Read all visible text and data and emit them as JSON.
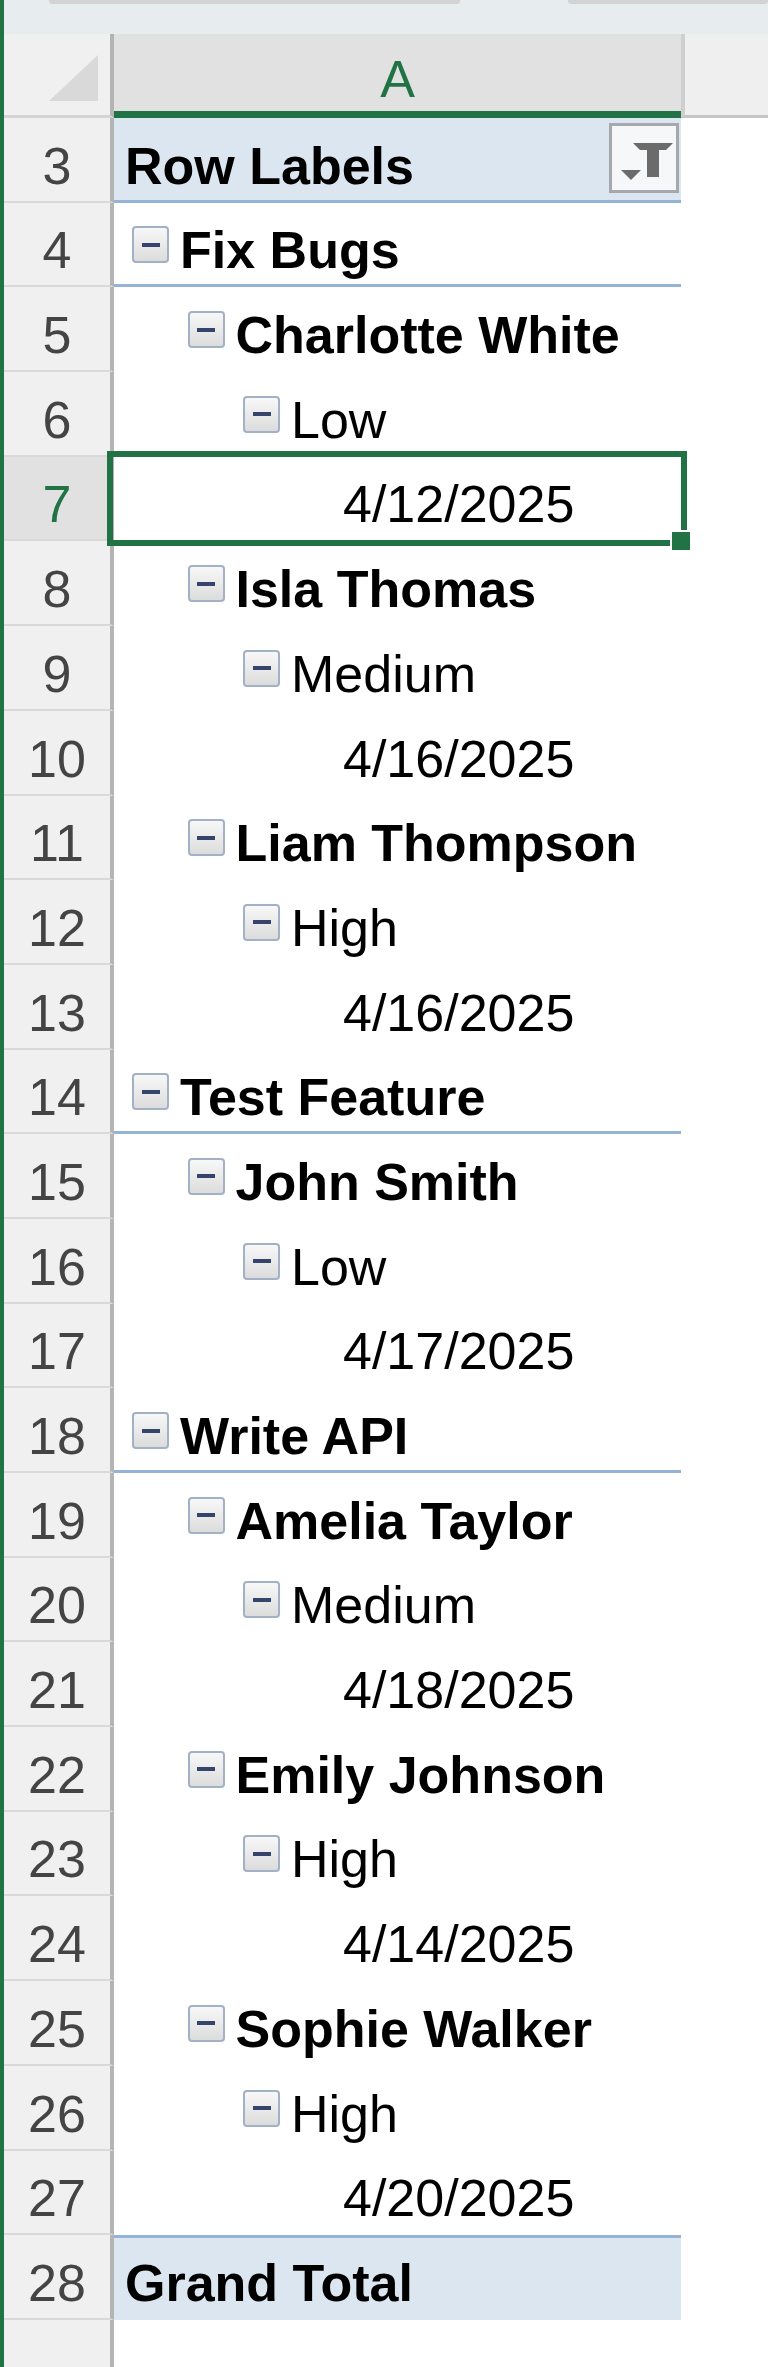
{
  "column_header": {
    "label": "A",
    "selected": true
  },
  "pivot": {
    "header": {
      "row": "3",
      "label": "Row Labels",
      "filtered": true
    },
    "items": [
      {
        "row": "4",
        "label": "Fix Bugs",
        "expanded": true,
        "selected": false,
        "children": [
          {
            "row": "5",
            "label": "Charlotte White",
            "expanded": true,
            "selected": false,
            "children": [
              {
                "row": "6",
                "label": "Low",
                "expanded": true,
                "selected": false,
                "children": [
                  {
                    "row": "7",
                    "label": "4/12/2025",
                    "selected": true
                  }
                ]
              }
            ]
          },
          {
            "row": "8",
            "label": "Isla Thomas",
            "expanded": true,
            "selected": false,
            "children": [
              {
                "row": "9",
                "label": "Medium",
                "expanded": true,
                "selected": false,
                "children": [
                  {
                    "row": "10",
                    "label": "4/16/2025",
                    "selected": false
                  }
                ]
              }
            ]
          },
          {
            "row": "11",
            "label": "Liam Thompson",
            "expanded": true,
            "selected": false,
            "children": [
              {
                "row": "12",
                "label": "High",
                "expanded": true,
                "selected": false,
                "children": [
                  {
                    "row": "13",
                    "label": "4/16/2025",
                    "selected": false
                  }
                ]
              }
            ]
          }
        ]
      },
      {
        "row": "14",
        "label": "Test Feature",
        "expanded": true,
        "selected": false,
        "children": [
          {
            "row": "15",
            "label": "John Smith",
            "expanded": true,
            "selected": false,
            "children": [
              {
                "row": "16",
                "label": "Low",
                "expanded": true,
                "selected": false,
                "children": [
                  {
                    "row": "17",
                    "label": "4/17/2025",
                    "selected": false
                  }
                ]
              }
            ]
          }
        ]
      },
      {
        "row": "18",
        "label": "Write API",
        "expanded": true,
        "selected": false,
        "children": [
          {
            "row": "19",
            "label": "Amelia Taylor",
            "expanded": true,
            "selected": false,
            "children": [
              {
                "row": "20",
                "label": "Medium",
                "expanded": true,
                "selected": false,
                "children": [
                  {
                    "row": "21",
                    "label": "4/18/2025",
                    "selected": false
                  }
                ]
              }
            ]
          },
          {
            "row": "22",
            "label": "Emily Johnson",
            "expanded": true,
            "selected": false,
            "children": [
              {
                "row": "23",
                "label": "High",
                "expanded": true,
                "selected": false,
                "children": [
                  {
                    "row": "24",
                    "label": "4/14/2025",
                    "selected": false
                  }
                ]
              }
            ]
          },
          {
            "row": "25",
            "label": "Sophie Walker",
            "expanded": true,
            "selected": false,
            "children": [
              {
                "row": "26",
                "label": "High",
                "expanded": true,
                "selected": false,
                "children": [
                  {
                    "row": "27",
                    "label": "4/20/2025",
                    "selected": false
                  }
                ]
              }
            ]
          }
        ]
      }
    ],
    "grand_total": {
      "row": "28",
      "label": "Grand Total"
    }
  }
}
